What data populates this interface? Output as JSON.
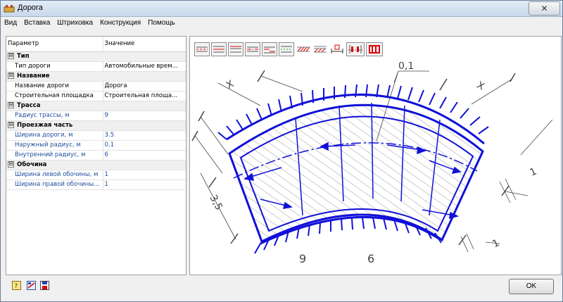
{
  "window": {
    "title": "Дорога",
    "close_symbol": "✕"
  },
  "menu": [
    "Вид",
    "Вставка",
    "Штриховка",
    "Конструкция",
    "Помощь"
  ],
  "props": {
    "col_param": "Параметр",
    "col_value": "Значение",
    "rows": [
      {
        "kind": "cat",
        "label": "Тип",
        "symbol": "⊟"
      },
      {
        "kind": "item",
        "label": "Тип дороги",
        "value": "Автомобильные врем...",
        "blue": false
      },
      {
        "kind": "cat",
        "label": "Название",
        "symbol": "⊟"
      },
      {
        "kind": "item",
        "label": "Название дороги",
        "value": "Дорога",
        "blue": false
      },
      {
        "kind": "item",
        "label": "Строительная площадка",
        "value": "Строительная площа...",
        "blue": false
      },
      {
        "kind": "cat",
        "label": "Трасса",
        "symbol": "⊟"
      },
      {
        "kind": "item",
        "label": "Радиус трассы, м",
        "value": "9",
        "blue": true
      },
      {
        "kind": "cat",
        "label": "Проезжая часть",
        "symbol": "⊟"
      },
      {
        "kind": "item",
        "label": "Ширина дороги, м",
        "value": "3.5",
        "blue": true
      },
      {
        "kind": "item",
        "label": "Наружный радиус, м",
        "value": "0.1",
        "blue": true
      },
      {
        "kind": "item",
        "label": "Внутренний радиус, м",
        "value": "6",
        "blue": true
      },
      {
        "kind": "cat",
        "label": "Обочина",
        "symbol": "⊟"
      },
      {
        "kind": "item",
        "label": "Ширина левой обочины, м",
        "value": "1",
        "blue": true
      },
      {
        "kind": "item",
        "label": "Ширина правой обочины, м",
        "value": "1",
        "blue": true
      }
    ]
  },
  "drawing": {
    "dim_top": "0,1",
    "dim_left_x": "X",
    "dim_right_x": "X",
    "dim_width": "3,5",
    "dim_outer_radius": "9",
    "dim_inner_radius": "6",
    "dim_right_upper": "1",
    "dim_right_lower": "1"
  },
  "buttons": {
    "ok": "OK"
  },
  "colors": {
    "road": "#1010d8",
    "line": "#555555"
  }
}
